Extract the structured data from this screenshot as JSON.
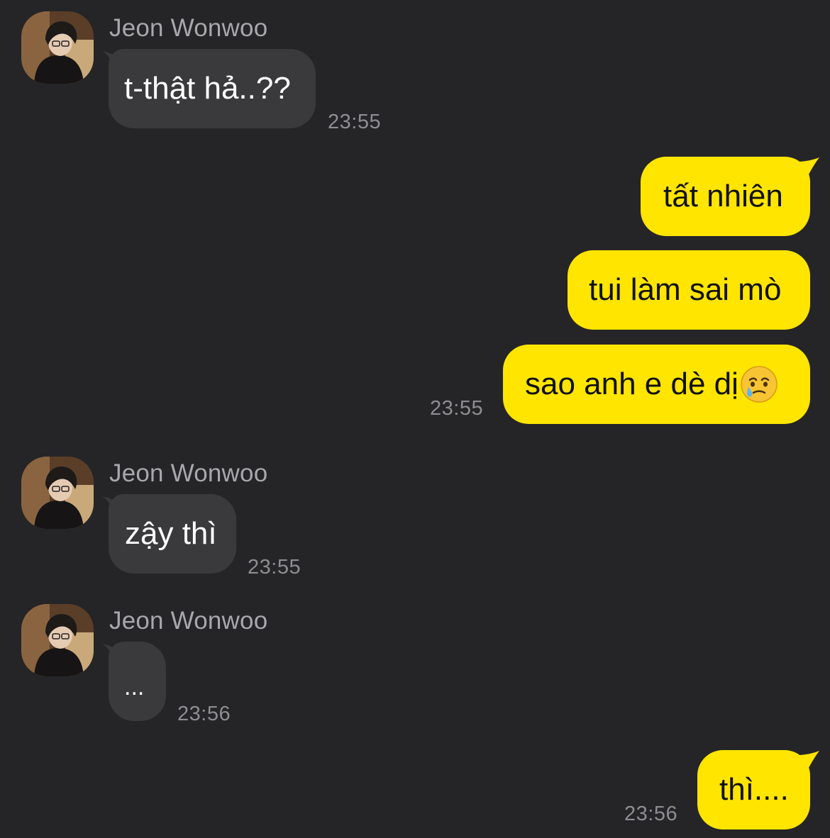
{
  "colors": {
    "background": "#252527",
    "incoming_bubble": "#3a3a3d",
    "outgoing_bubble": "#ffe500",
    "sender_name": "#a8a8ac",
    "timestamp": "#8e8e92"
  },
  "messages": [
    {
      "direction": "incoming",
      "sender": "Jeon Wonwoo",
      "avatar_icon": "profile-photo",
      "bubbles": [
        "t-thật hả..??"
      ],
      "time": "23:55"
    },
    {
      "direction": "outgoing",
      "bubbles": [
        "tất nhiên",
        "tui làm sai mò",
        "sao anh e dè dị"
      ],
      "emoji": "face-holding-back-tears-icon",
      "time": "23:55"
    },
    {
      "direction": "incoming",
      "sender": "Jeon Wonwoo",
      "avatar_icon": "profile-photo",
      "bubbles": [
        "zậy thì"
      ],
      "time": "23:55"
    },
    {
      "direction": "incoming",
      "sender": "Jeon Wonwoo",
      "avatar_icon": "profile-photo",
      "bubbles": [
        "..."
      ],
      "time": "23:56"
    },
    {
      "direction": "outgoing",
      "bubbles": [
        "thì...."
      ],
      "time": "23:56"
    }
  ]
}
